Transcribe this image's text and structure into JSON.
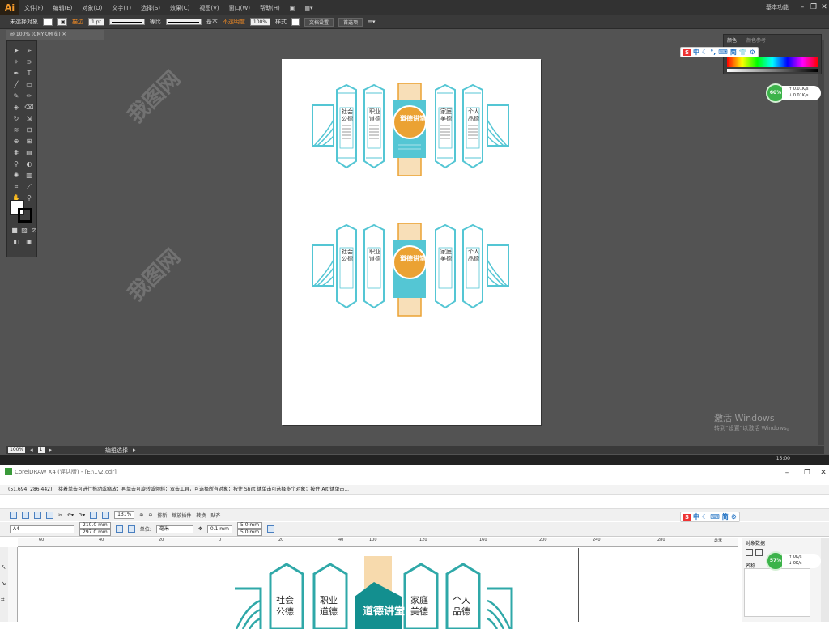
{
  "illustrator": {
    "logo": "Ai",
    "menus": [
      "文件(F)",
      "编辑(E)",
      "对象(O)",
      "文字(T)",
      "选择(S)",
      "效果(C)",
      "视图(V)",
      "窗口(W)",
      "帮助(H)"
    ],
    "workspace": "基本功能",
    "control": {
      "selection": "未选择对象",
      "stroke_label": "描边",
      "stroke_weight": "1 pt",
      "stroke_profile": "等比",
      "brush": "基本",
      "opacity_label": "不透明度",
      "opacity_value": "100%",
      "style_label": "样式",
      "doc_setup": "文档设置",
      "prefs": "首选项"
    },
    "doc_tab": "@ 100% (CMYK/预览)",
    "color_panel": {
      "tab1": "颜色",
      "tab2": "颜色参考"
    },
    "status": {
      "zoom": "100%",
      "page": "1",
      "mode": "编组选择"
    },
    "clock": "15:00",
    "activate": {
      "line1": "激活 Windows",
      "line2": "转到“设置”以激活 Windows。"
    },
    "speed": {
      "percent": "60%",
      "up": "0.01K/s",
      "down": "0.01K/s"
    }
  },
  "design": {
    "center_title": "道德讲堂",
    "panels": [
      {
        "title1": "社会",
        "title2": "公德"
      },
      {
        "title1": "职业",
        "title2": "道德"
      },
      {
        "title1": "家庭",
        "title2": "美德"
      },
      {
        "title1": "个人",
        "title2": "品德"
      }
    ],
    "colors": {
      "teal": "#54c6d4",
      "orange": "#eba233"
    }
  },
  "coreldraw": {
    "title": "CorelDRAW X4 (评估版) - [E:\\..\\2.cdr]",
    "coords": "(51.694, 286.442)",
    "hint": "接着单击可进行拖动或缩放；再单击可旋转或倾斜；双击工具，可选择所有对象；按住 Shift 键单击可选择多个对象；按住 Alt 键单击...",
    "zoom": "131%",
    "buttons": {
      "snap": "贴齐",
      "launcher": "排新",
      "plugin": "缩放插件",
      "convert": "转换"
    },
    "page_size": "A4",
    "width": "210.0 mm",
    "height": "297.0 mm",
    "units_label": "单位:",
    "units": "毫米",
    "nudge": "0.1 mm",
    "dup_x": "5.0 mm",
    "dup_y": "5.0 mm",
    "ruler": [
      "80",
      "60",
      "40",
      "20",
      "0",
      "20",
      "40",
      "60",
      "80",
      "100",
      "120",
      "140",
      "160",
      "180",
      "200",
      "220",
      "240",
      "260",
      "280"
    ],
    "ruler_unit": "毫米",
    "panel_title": "对象数据",
    "panel_name": "名称",
    "speed": {
      "percent": "57%",
      "up": "0K/s",
      "down": "0K/s"
    }
  },
  "ime": {
    "items": [
      "中",
      "简"
    ]
  },
  "watermark": "我图网"
}
